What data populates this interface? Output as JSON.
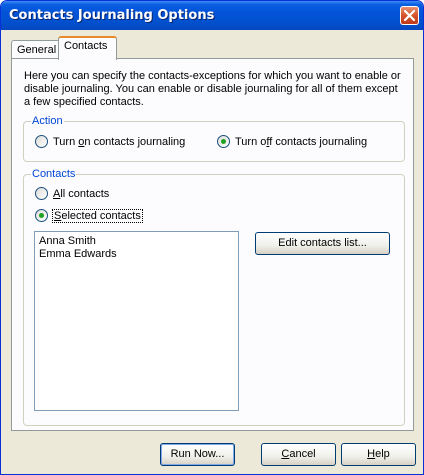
{
  "window": {
    "title": "Contacts Journaling Options"
  },
  "tabs": [
    {
      "label": "General"
    },
    {
      "label": "Contacts"
    }
  ],
  "description": "Here you can specify the contacts-exceptions for which you want to enable or disable journaling. You can enable or disable journaling for all of them except a few specified contacts.",
  "action_group": {
    "legend": "Action",
    "option_on": {
      "pre": "Turn ",
      "key": "o",
      "post": "n contacts journaling"
    },
    "option_off": {
      "pre": "Turn o",
      "key": "f",
      "post": "f contacts journaling"
    },
    "selected": "off"
  },
  "contacts_group": {
    "legend": "Contacts",
    "option_all": {
      "pre": "",
      "key": "A",
      "post": "ll contacts"
    },
    "option_selected": {
      "pre": "",
      "key": "S",
      "post": "elected contacts"
    },
    "selected": "selected",
    "list": [
      "Anna Smith",
      "Emma Edwards"
    ],
    "edit_button": "Edit contacts list..."
  },
  "buttons": {
    "run_now": "Run Now...",
    "cancel_pre": "",
    "cancel_key": "C",
    "cancel_post": "ancel",
    "help_pre": "",
    "help_key": "H",
    "help_post": "elp"
  }
}
